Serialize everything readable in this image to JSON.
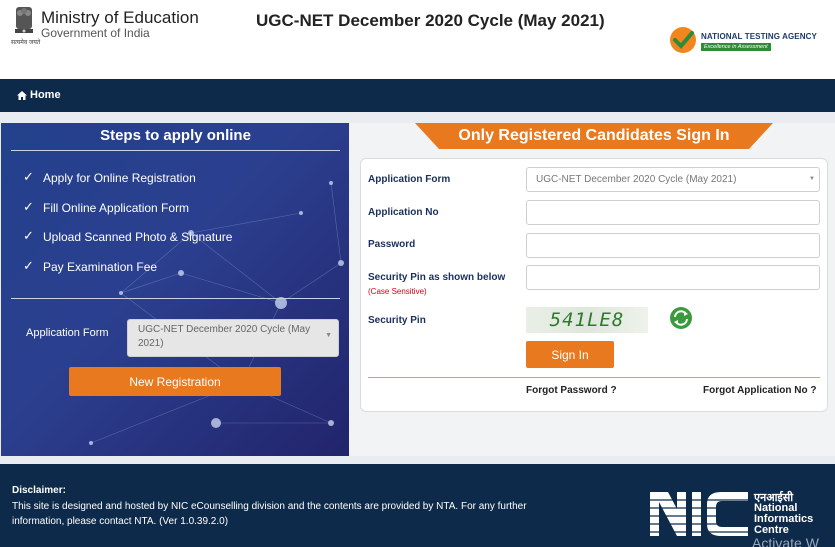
{
  "header": {
    "ministry": "Ministry of Education",
    "government": "Government of India",
    "emblem_caption": "सत्यमेव जयते",
    "title": "UGC-NET December 2020 Cycle (May 2021)",
    "nta_name": "NATIONAL TESTING AGENCY",
    "nta_tagline": "Excellence in Assessment"
  },
  "nav": {
    "home": "Home"
  },
  "steps": {
    "title": "Steps to apply online",
    "items": [
      "Apply for Online Registration",
      "Fill Online Application Form",
      "Upload Scanned Photo & Signature",
      "Pay Examination Fee"
    ],
    "check_mark": "✓",
    "form_label": "Application Form",
    "form_value": "UGC-NET December 2020 Cycle (May 2021)",
    "new_registration": "New Registration"
  },
  "signin": {
    "title": "Only Registered Candidates Sign In",
    "form_label": "Application Form",
    "form_value": "UGC-NET December 2020 Cycle (May 2021)",
    "app_no_label": "Application No",
    "password_label": "Password",
    "pin_label": "Security Pin as shown below",
    "case_sensitive": "(Case Sensitive)",
    "security_pin_label": "Security Pin",
    "captcha": "541LE8",
    "sign_in": "Sign In",
    "forgot_password": "Forgot Password ?",
    "forgot_app_no": "Forgot Application No ?"
  },
  "footer": {
    "disclaimer_title": "Disclaimer:",
    "disclaimer_text": "This site is designed and hosted by NIC eCounselling division and the contents are provided by NTA. For any further information, please contact NTA. (Ver 1.0.39.2.0)",
    "nic_hindi": "एनआईसी",
    "nic_line1": "National",
    "nic_line2": "Informatics",
    "nic_line3": "Centre",
    "watermark": "Activate W"
  },
  "colors": {
    "navy": "#0e2a4a",
    "orange": "#e8791f",
    "label_blue": "#1a2f5e",
    "captcha_green": "#2d7a2d"
  },
  "icons": {
    "home": "home-icon",
    "refresh": "refresh-icon",
    "emblem": "emblem-icon",
    "nta_logo": "nta-logo-icon"
  }
}
